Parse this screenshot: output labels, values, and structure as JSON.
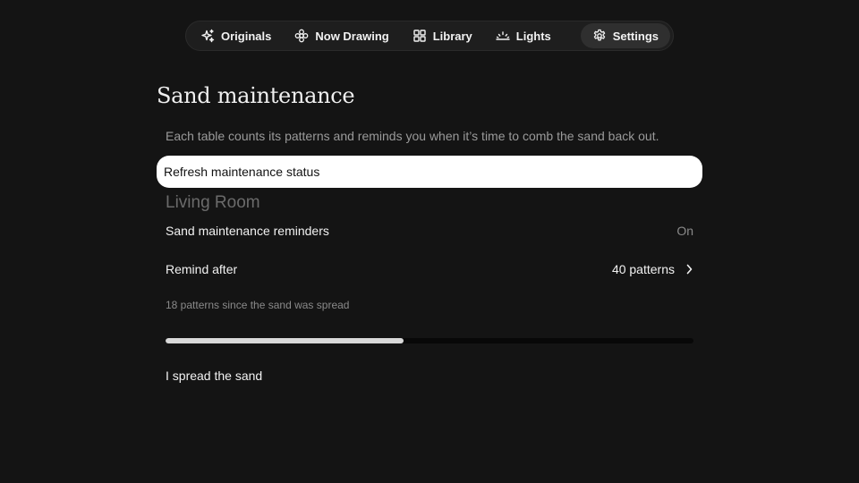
{
  "nav": {
    "items": [
      {
        "label": "Originals",
        "icon": "sparkle-icon"
      },
      {
        "label": "Now Drawing",
        "icon": "flower-icon"
      },
      {
        "label": "Library",
        "icon": "grid-icon"
      },
      {
        "label": "Lights",
        "icon": "sunrise-icon"
      },
      {
        "label": "Settings",
        "icon": "gear-icon",
        "active": true
      }
    ]
  },
  "page": {
    "title": "Sand maintenance",
    "description": "Each table counts its patterns and reminds you when it’s time to comb the sand back out.",
    "refresh_label": "Refresh maintenance status"
  },
  "table": {
    "name": "Living Room",
    "reminders_label": "Sand maintenance reminders",
    "reminders_value": "On",
    "remind_after_label": "Remind after",
    "remind_after_value": "40 patterns",
    "count_text": "18 patterns since the sand was spread",
    "progress_fraction": 0.45,
    "spread_label": "I spread the sand"
  },
  "colors": {
    "background": "#141414",
    "nav_background": "#1e1e1e",
    "nav_active": "#2f2f2f",
    "button_background": "#ffffff",
    "progress_fill": "#d9d9d9",
    "muted_text": "#8a8a8a"
  }
}
